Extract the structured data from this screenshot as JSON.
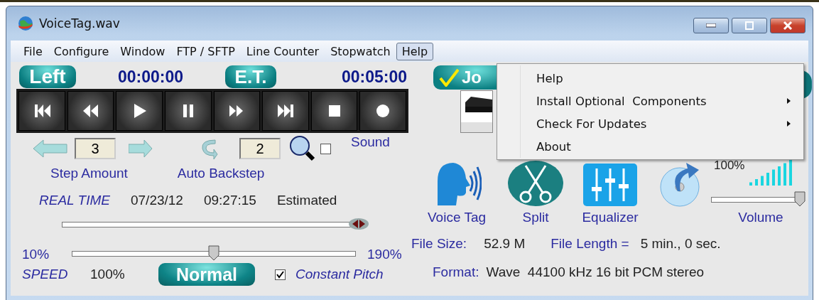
{
  "window": {
    "title": "VoiceTag.wav"
  },
  "menu": [
    {
      "label": "File",
      "selected": false
    },
    {
      "label": "Configure",
      "selected": false
    },
    {
      "label": "Window",
      "selected": false
    },
    {
      "label": "FTP / SFTP",
      "selected": false
    },
    {
      "label": "Line Counter",
      "selected": false
    },
    {
      "label": "Stopwatch",
      "selected": false
    },
    {
      "label": "Help",
      "selected": true
    }
  ],
  "help_menu": [
    {
      "label": "Help",
      "submenu": false
    },
    {
      "label": "Install Optional  Components",
      "submenu": true
    },
    {
      "label": "Check For Updates",
      "submenu": true
    },
    {
      "label": "About",
      "submenu": false
    }
  ],
  "counters": {
    "left_label": "Left",
    "left_time": "00:00:00",
    "et_label": "E.T.",
    "et_time": "00:05:00"
  },
  "step": {
    "value": "3",
    "label": "Step Amount"
  },
  "backstep": {
    "value": "2",
    "label": "Auto Backstep"
  },
  "sound": {
    "label": "Sound",
    "checked": false
  },
  "real_time": {
    "label": "REAL TIME",
    "date": "07/23/12",
    "time": "09:27:15",
    "note": "Estimated"
  },
  "position": {
    "level": 0.98
  },
  "speed": {
    "min": "10%",
    "max": "190%",
    "level": 0.5,
    "label": "SPEED",
    "value": "100%",
    "normal_button": "Normal"
  },
  "constant_pitch": {
    "label": "Constant Pitch",
    "checked": true
  },
  "job_button": "Jo",
  "tools": [
    {
      "kind": "voice",
      "label": "Voice Tag"
    },
    {
      "kind": "split",
      "label": "Split"
    },
    {
      "kind": "equalizer",
      "label": "Equalizer"
    },
    {
      "kind": "disc"
    }
  ],
  "volume": {
    "reading": "100%",
    "level": 0.97,
    "label": "Volume"
  },
  "file_info": {
    "size_label": "File Size:",
    "size": "52.9 M",
    "length_label": "File Length =",
    "length": "5 min., 0 sec.",
    "format_label": "Format:",
    "format": "Wave  44100 kHz 16 bit PCM stereo"
  }
}
